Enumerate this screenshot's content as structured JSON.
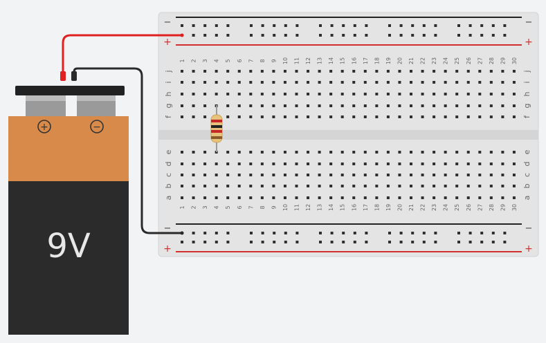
{
  "battery": {
    "label": "9V",
    "positive_symbol": "+",
    "negative_symbol": "−",
    "colors": {
      "top": "#d88a4a",
      "bottom": "#2b2b2b",
      "cap": "#222222",
      "terminal": "#9a9a9a",
      "label": "#e8e8e8"
    }
  },
  "breadboard": {
    "columns": 30,
    "top_rows": [
      "j",
      "i",
      "h",
      "g",
      "f"
    ],
    "bottom_rows": [
      "e",
      "d",
      "c",
      "b",
      "a"
    ],
    "rail_minus": "−",
    "rail_plus": "+",
    "colors": {
      "board": "#e4e4e4",
      "hole": "#2e2e2e",
      "text": "#666666",
      "rail_red": "#d32f2f",
      "rail_black": "#222222"
    }
  },
  "wires": [
    {
      "name": "red-wire",
      "color": "#e02020",
      "from": "battery-positive",
      "to": "top-rail-plus"
    },
    {
      "name": "black-wire",
      "color": "#222222",
      "from": "battery-negative",
      "to": "bottom-rail-minus"
    }
  ],
  "resistor": {
    "column": 4,
    "from_row": "g",
    "to_row": "e",
    "bands": [
      "#c62828",
      "#222222",
      "#c62828",
      "#8b5a2b"
    ],
    "body_color": "#e6c27a"
  }
}
